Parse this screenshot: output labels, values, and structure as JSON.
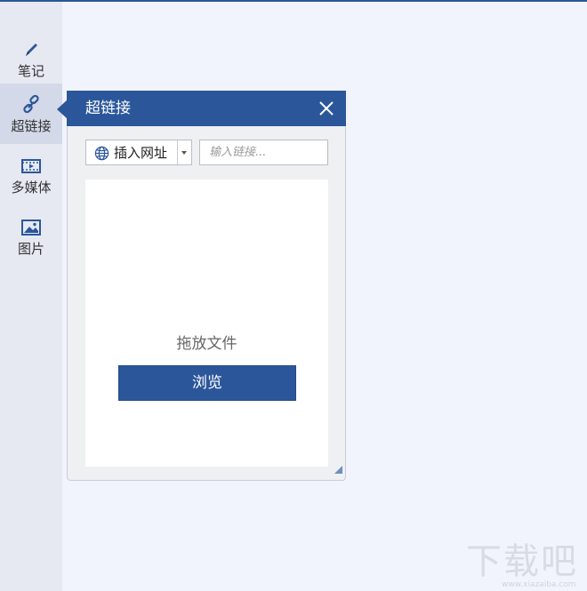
{
  "sidebar": {
    "items": [
      {
        "label": "笔记",
        "icon": "pen-icon"
      },
      {
        "label": "超链接",
        "icon": "link-icon",
        "active": true
      },
      {
        "label": "多媒体",
        "icon": "video-icon"
      },
      {
        "label": "图片",
        "icon": "image-icon"
      }
    ]
  },
  "panel": {
    "title": "超链接",
    "url_select": {
      "selected": "插入网址",
      "icon": "globe-icon"
    },
    "link_input": {
      "placeholder": "输入链接..."
    },
    "drop_text": "拖放文件",
    "browse_label": "浏览"
  },
  "watermark": {
    "text": "下载吧",
    "url": "www.xiazaiba.com"
  },
  "colors": {
    "accent": "#2b579a",
    "sidebar_bg": "#e6e9f2",
    "sidebar_active_bg": "#d3d9e8",
    "page_bg": "#f2f4fd",
    "panel_bg": "#eef0f2"
  }
}
